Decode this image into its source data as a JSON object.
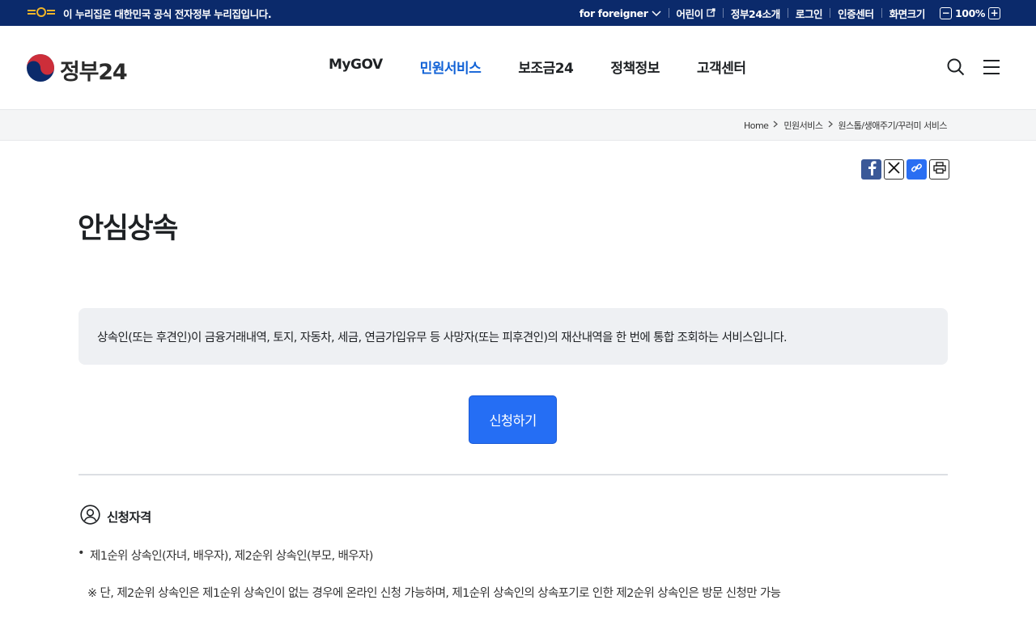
{
  "gov_banner": {
    "text": "이 누리집은 대한민국 공식 전자정부 누리집입니다.",
    "links": [
      "for foreigner",
      "어린이",
      "정부24소개",
      "로그인",
      "인증센터",
      "화면크기"
    ],
    "zoom_value": "100%",
    "zoom_minus": "−",
    "zoom_plus": "+"
  },
  "header": {
    "logo_text": "정부24",
    "nav": [
      {
        "label": "MyGOV",
        "active": false
      },
      {
        "label": "민원서비스",
        "active": true
      },
      {
        "label": "보조금24",
        "active": false
      },
      {
        "label": "정책정보",
        "active": false
      },
      {
        "label": "고객센터",
        "active": false
      }
    ]
  },
  "breadcrumb": [
    "Home",
    "민원서비스",
    "원스톱/생애주기/꾸러미 서비스"
  ],
  "page": {
    "title": "안심상속",
    "description": "상속인(또는 후견인)이 금융거래내역, 토지, 자동차, 세금, 연금가입유무 등 사망자(또는 피후견인)의 재산내역을 한 번에 통합 조회하는 서비스입니다.",
    "apply_label": "신청하기"
  },
  "eligibility": {
    "heading": "신청자격",
    "bullet_mark": "•",
    "bullet": "제1순위 상속인(자녀, 배우자), 제2순위 상속인(부모, 배우자)",
    "note": "※ 단, 제2순위 상속인은 제1순위 상속인이 없는 경우에 온라인 신청 가능하며, 제1순위 상속인의 상속포기로 인한 제2순위 상속인은 방문 신청만 가능"
  },
  "colors": {
    "gov_bar": "#0b2a6b",
    "accent": "#256ef4",
    "active_nav": "#1162d6"
  }
}
